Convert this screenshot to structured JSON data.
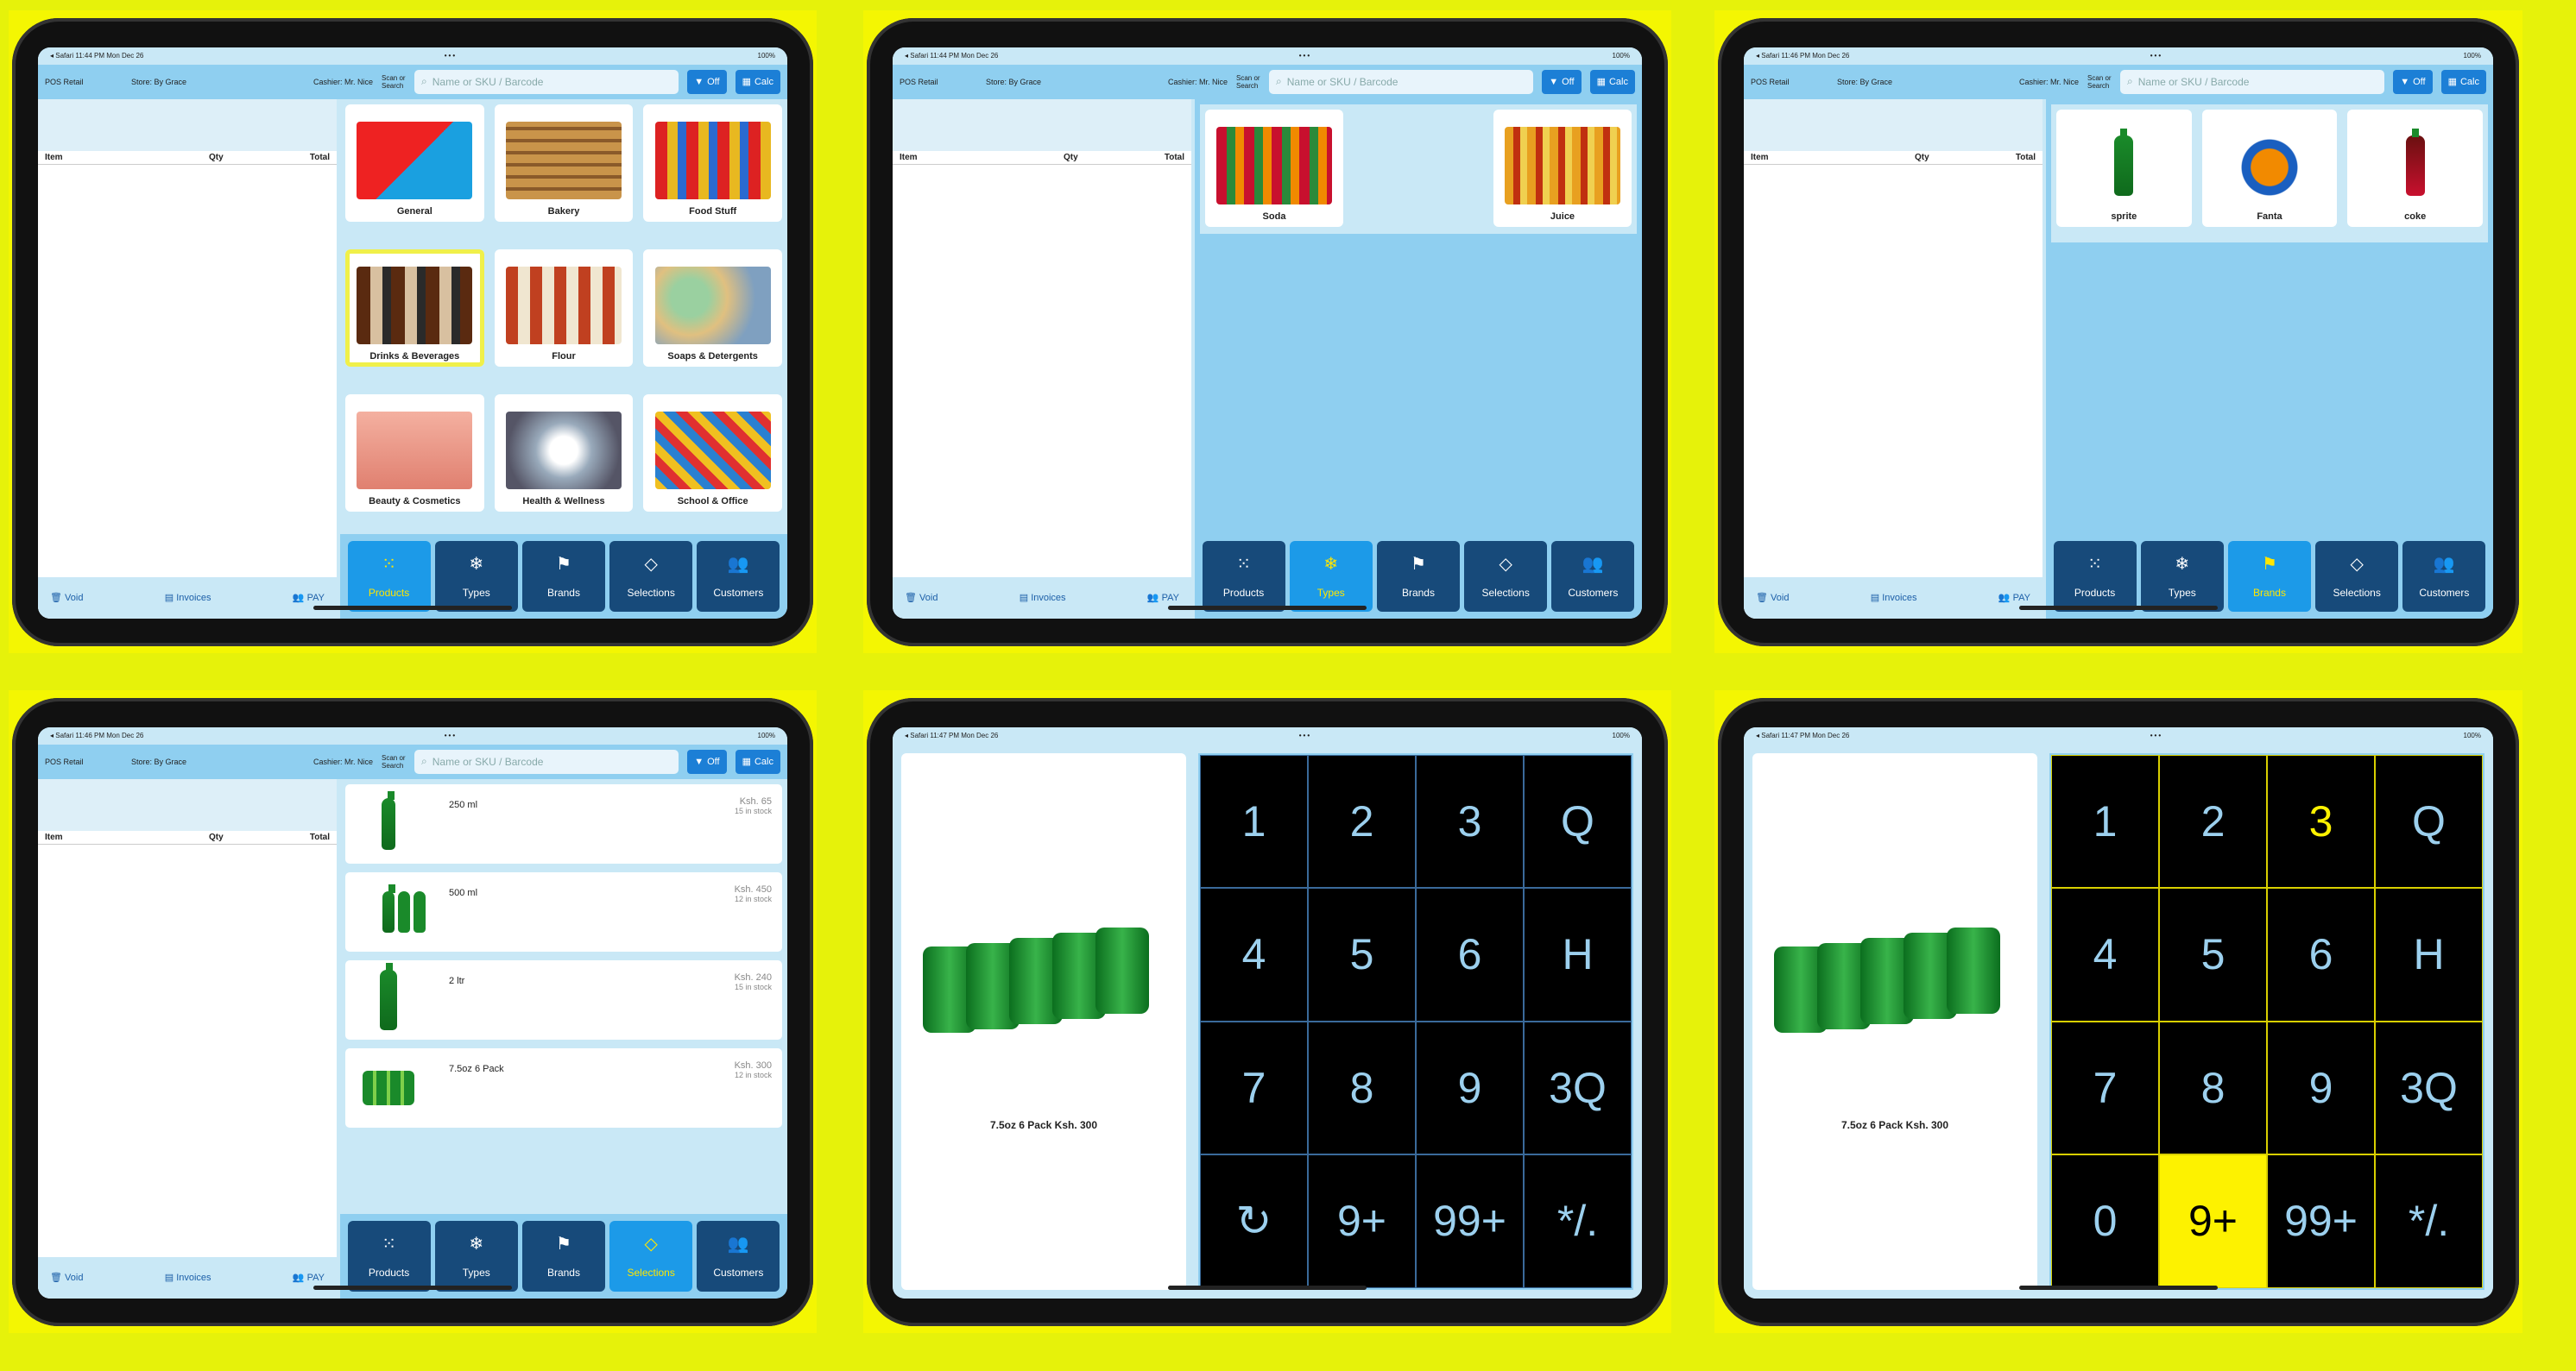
{
  "status": {
    "left_1": "◂ Safari  11:44 PM  Mon Dec 26",
    "left_2": "◂ Safari  11:46 PM  Mon Dec 26",
    "left_3": "◂ Safari  11:47 PM  Mon Dec 26",
    "right": "100%",
    "dots": "•••"
  },
  "header": {
    "app": "POS Retail",
    "store": "Store: By Grace",
    "cashier": "Cashier: Mr. Nice",
    "scan_label": "Scan or Search",
    "search_placeholder": "Name or SKU / Barcode",
    "off_label": "Off",
    "calc_label": "Calc"
  },
  "cart": {
    "col_item": "Item",
    "col_qty": "Qty",
    "col_total": "Total",
    "void": "Void",
    "invoices": "Invoices",
    "pay": "PAY"
  },
  "nav": [
    "Products",
    "Types",
    "Brands",
    "Selections",
    "Customers"
  ],
  "categories": [
    {
      "label": "General"
    },
    {
      "label": "Bakery"
    },
    {
      "label": "Food Stuff"
    },
    {
      "label": "Drinks & Beverages"
    },
    {
      "label": "Flour"
    },
    {
      "label": "Soaps & Detergents"
    },
    {
      "label": "Beauty & Cosmetics"
    },
    {
      "label": "Health & Wellness"
    },
    {
      "label": "School & Office"
    }
  ],
  "types": [
    {
      "label": "Soda"
    },
    {
      "label": "Juice"
    }
  ],
  "brands": [
    {
      "label": "sprite"
    },
    {
      "label": "Fanta"
    },
    {
      "label": "coke"
    }
  ],
  "selections": [
    {
      "name": "250 ml",
      "price": "Ksh. 65",
      "stock": "15 in stock"
    },
    {
      "name": "500 ml",
      "price": "Ksh. 450",
      "stock": "12 in stock"
    },
    {
      "name": "2 ltr",
      "price": "Ksh. 240",
      "stock": "15 in stock"
    },
    {
      "name": "7.5oz 6 Pack",
      "price": "Ksh. 300",
      "stock": "12 in stock"
    }
  ],
  "keypad": {
    "product_caption": "7.5oz 6 Pack   Ksh. 300",
    "keys_a": [
      "1",
      "2",
      "3",
      "Q",
      "4",
      "5",
      "6",
      "H",
      "7",
      "8",
      "9",
      "3Q",
      "↻",
      "9+",
      "99+",
      "*/."
    ],
    "keys_b": [
      "1",
      "2",
      "3",
      "Q",
      "4",
      "5",
      "6",
      "H",
      "7",
      "8",
      "9",
      "3Q",
      "0",
      "9+",
      "99+",
      "*/."
    ]
  },
  "colors": {
    "accent": "#1c9ae8",
    "nav": "#174a7a",
    "highlight": "#fdf200",
    "frame_bg": "#e6f20a"
  }
}
